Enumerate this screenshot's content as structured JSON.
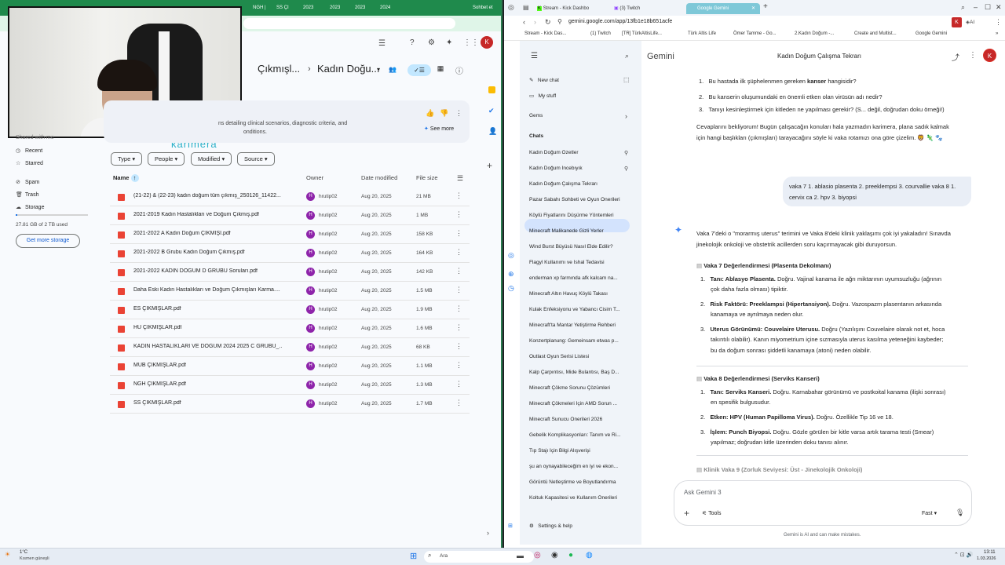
{
  "left_tabs": [
    "NGH |",
    "SS ÇI",
    "2023",
    "2023",
    "2023",
    "2024",
    "Sohbet et"
  ],
  "drive": {
    "breadcrumb": [
      "Çıkmışl...",
      "Kadın Doğu..."
    ],
    "banner_text": "ns detailing clinical scenarios, diagnostic criteria, and",
    "banner_text2": "onditions.",
    "see_more": "See more",
    "filters": [
      "Type",
      "People",
      "Modified",
      "Source"
    ],
    "columns": {
      "name": "Name",
      "owner": "Owner",
      "date": "Date modified",
      "size": "File size"
    },
    "files": [
      {
        "name": "(21-22) & (22-23) kadın doğum tüm çıkmış_250126_11422...",
        "owner": "hrutip02",
        "date": "Aug 20, 2025",
        "size": "21 MB"
      },
      {
        "name": "2021-2019 Kadın Hastalıkları ve Doğum Çıkmış.pdf",
        "owner": "hrutip02",
        "date": "Aug 20, 2025",
        "size": "1 MB"
      },
      {
        "name": "2021-2022 A Kadın Doğum ÇIKMIŞI.pdf",
        "owner": "hrutip02",
        "date": "Aug 20, 2025",
        "size": "158 KB"
      },
      {
        "name": "2021-2022 B Grubu Kadın Doğum Çıkmış.pdf",
        "owner": "hrutip02",
        "date": "Aug 20, 2025",
        "size": "164 KB"
      },
      {
        "name": "2021-2022 KADIN DOĞUM D GRUBU Soruları.pdf",
        "owner": "hrutip02",
        "date": "Aug 20, 2025",
        "size": "142 KB"
      },
      {
        "name": "Daha Eski Kadın Hastalıkları ve Doğum Çıkmışları Karma....",
        "owner": "hrutip02",
        "date": "Aug 20, 2025",
        "size": "1.5 MB"
      },
      {
        "name": "ES ÇIKMIŞLAR.pdf",
        "owner": "hrutip02",
        "date": "Aug 20, 2025",
        "size": "1.9 MB"
      },
      {
        "name": "HU ÇIKMIŞLAR.pdf",
        "owner": "hrutip02",
        "date": "Aug 20, 2025",
        "size": "1.6 MB"
      },
      {
        "name": "KADIN HASTALIKLARI VE DOĞUM 2024 2025  C GRUBU_...",
        "owner": "hrutip02",
        "date": "Aug 20, 2025",
        "size": "68 KB"
      },
      {
        "name": "MUB ÇIKMIŞLAR.pdf",
        "owner": "hrutip02",
        "date": "Aug 20, 2025",
        "size": "1.1 MB"
      },
      {
        "name": "NGH ÇIKMIŞLAR.pdf",
        "owner": "hrutip02",
        "date": "Aug 20, 2025",
        "size": "1.3 MB"
      },
      {
        "name": "SS ÇIKMIŞLAR.pdf",
        "owner": "hrutip02",
        "date": "Aug 20, 2025",
        "size": "1.7 MB"
      }
    ],
    "sidebar": {
      "shared": "Shared with me",
      "recent": "Recent",
      "starred": "Starred",
      "spam": "Spam",
      "trash": "Trash",
      "storage": "Storage",
      "usage": "27.81 GB of 2 TB used",
      "get_more": "Get more storage"
    }
  },
  "overlay_text": "karimera",
  "right_tabs": [
    "Stream - Kick Dashbo",
    "(3) Twitch",
    "Google Gemini"
  ],
  "url": "gemini.google.com/app/13fb1e18b651acfe",
  "bookmarks": [
    "Stream - Kick Das...",
    "(1) Twitch",
    "[TR] TürkAltisLife...",
    "Türk Altis Life",
    "Ömer Tamme - Go...",
    "2.Kadın Doğum -...",
    "Create and Multist...",
    "Google Gemini"
  ],
  "gemini": {
    "brand": "Gemini",
    "title": "Kadın Doğum Çalışma Tekrarı",
    "new_chat": "New chat",
    "my_stuff": "My stuff",
    "gems": "Gems",
    "chats": "Chats",
    "settings": "Settings & help",
    "chat_list": [
      "Kadın Doğum Özetler",
      "Kadın Doğum İncebıyık",
      "Kadın Doğum Çalışma Tekrarı",
      "Pazar Sabahı Sohbeti ve Oyun Önerileri",
      "Köylü Fiyatlarını Düşürme Yöntemleri",
      "Minecraft Malikanede Gizli Yerler",
      "Wind Burst Büyüsü Nasıl Elde Edilir?",
      "Flagyl Kullanımı ve İshal Tedavisi",
      "enderman xp farmında afk kalcam na...",
      "Minecraft Altın Havuç Köylü Takası",
      "Kulak Enfeksiyonu ve Yabancı Cisim T...",
      "Minecraft'ta Mantar Yetiştirme Rehberi",
      "Konzertplanung: Gemeinsam etwas p...",
      "Outlast Oyun Serisi Listesi",
      "Kalp Çarpıntısı, Mide Bulantısı, Baş D...",
      "Minecraft Çökme Sorunu Çözümleri",
      "Minecraft Çökmeleri İçin AMD Sorun ...",
      "Minecraft Sunucu Önerileri 2026",
      "Gebelik Komplikasyonları: Tanım ve Ri...",
      "Tıp Stajı İçin Bilgi Alışverişi",
      "şu an oynayabileceğim en iyi ve ekon...",
      "Görüntü Netleştirme ve Boyutlandırma",
      "Koltuk Kapasitesi ve Kullanım Önerileri"
    ],
    "q1": "Bu hastada ilk şüphelenmen gereken",
    "q1b": "kanser",
    "q1c": "hangisidir?",
    "q2": "Bu kanserin oluşumundaki en önemli etken olan virüsün adı nedir?",
    "q3": "Tanıyı kesinleştirmek için kitleden ne yapılması gerekir? (S... değil, doğrudan doku örneği!)",
    "p1": "Cevaplarını bekliyorum! Bugün çalışacağın konuları hala yazmadın karimera, plana sadık kalmak",
    "p2": "için hangi başlıkları (çıkmışları) tarayacağını söyle ki vaka rotamızı ona göre çizelim. 🦁 🦎 🐾",
    "user_msg": "vaka 7 1. ablasio plasenta 2. preeklempsi 3. courvallie vaka 8 1. cervix ca 2. hpv 3. biyopsi",
    "r1": "Vaka 7'deki o \"morarmış uterus\" terimini ve Vaka 8'deki klinik yaklaşımı çok iyi yakaladın! Sınavda",
    "r2": "jinekolojik onkoloji ve obstetrik acillerden soru kaçırmayacak gibi duruyorsun.",
    "h7": "Vaka 7 Değerlendirmesi (Plasenta Dekolmanı)",
    "a1": "Tanı: Ablasyo Plasenta.",
    "a1t": "Doğru. Vajinal kanama ile ağrı miktarının uyumsuzluğu (ağrının",
    "a1t2": "çok daha fazla olması) tipiktir.",
    "a2": "Risk Faktörü: Preeklampsi (Hipertansiyon).",
    "a2t": "Doğru. Vazospazm plasentanın arkasında",
    "a2t2": "kanamaya ve ayrılmaya neden olur.",
    "a3": "Uterus Görünümü: Couvelaire Uterusu.",
    "a3t": "Doğru (Yazılışını Couvelaire olarak not et, hoca",
    "a3t2": "takıntılı olabilir). Kanın miyometrium içine sızmasıyla uterus kasılma yeteneğini kaybeder;",
    "a3t3": "bu da doğum sonrası şiddetli kanamaya (atoni) neden olabilir.",
    "h8": "Vaka 8 Değerlendirmesi (Serviks Kanseri)",
    "b1": "Tanı: Serviks Kanseri.",
    "b1t": "Doğru. Karnabahar görünümü ve postkoital kanama (ilişki sonrası)",
    "b1t2": "en spesifik bulgusudur.",
    "b2": "Etken: HPV (Human Papilloma Virus).",
    "b2t": "Doğru. Özellikle Tip 16 ve 18.",
    "b3": "İşlem: Punch Biyopsi.",
    "b3t": "Doğru. Gözle görülen bir kitle varsa artık tarama testi (Smear)",
    "b3t2": "yapılmaz; doğrudan kitle üzerinden doku tanısı alınır.",
    "h9": "Klinik Vaka 9 (Zorluk Seviyesi: Üst - Jinekolojik Onkoloji)",
    "placeholder": "Ask Gemini 3",
    "tools": "Tools",
    "mode": "Fast",
    "disclaimer": "Gemini is AI and can make mistakes."
  },
  "taskbar": {
    "weather": "1°C",
    "weather2": "Kısmen güneşli",
    "search": "Ara",
    "time": "13:11",
    "date": "1.03.2026"
  }
}
